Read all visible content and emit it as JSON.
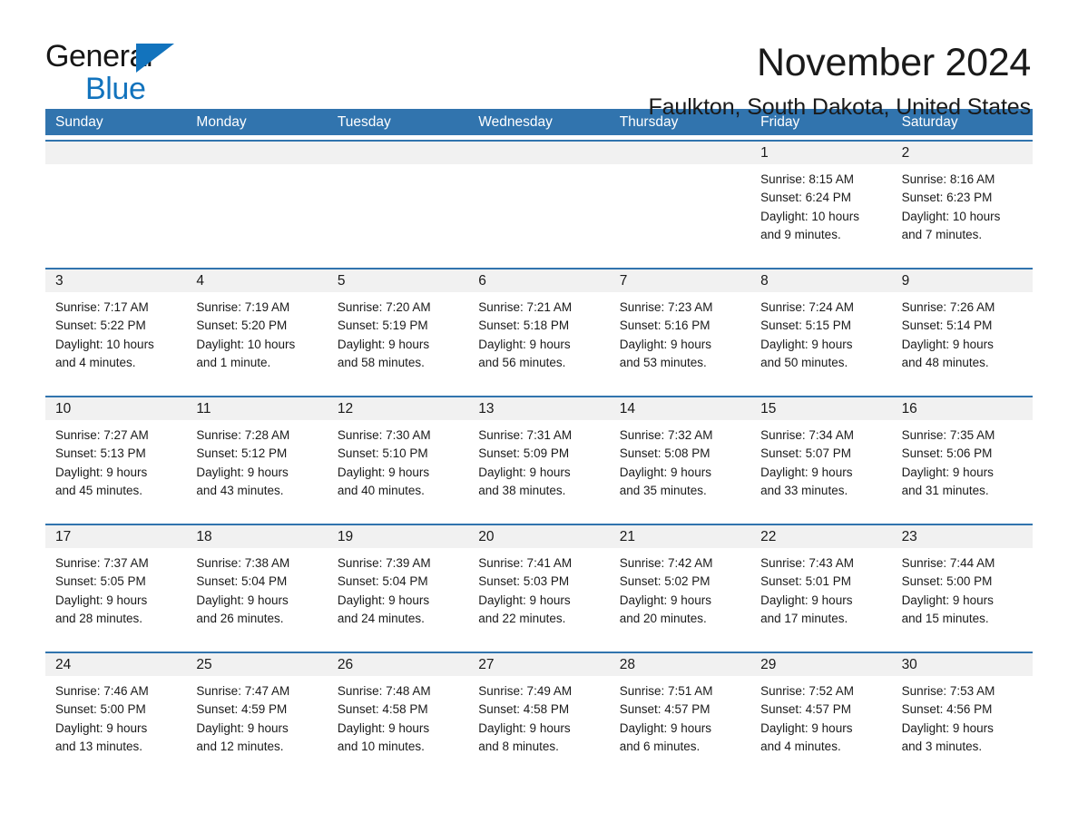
{
  "brand": {
    "name_part1": "General",
    "name_part2": "Blue",
    "logo_icon": "triangle-logo-icon",
    "accent_color": "#1273bd"
  },
  "header": {
    "month_title": "November 2024",
    "location": "Faulkton, South Dakota, United States"
  },
  "calendar": {
    "header_bg": "#3174ae",
    "daynum_band_bg": "#f1f1f1",
    "day_names": [
      "Sunday",
      "Monday",
      "Tuesday",
      "Wednesday",
      "Thursday",
      "Friday",
      "Saturday"
    ],
    "weeks": [
      [
        {
          "day": "",
          "lines": []
        },
        {
          "day": "",
          "lines": []
        },
        {
          "day": "",
          "lines": []
        },
        {
          "day": "",
          "lines": []
        },
        {
          "day": "",
          "lines": []
        },
        {
          "day": "1",
          "lines": [
            "Sunrise: 8:15 AM",
            "Sunset: 6:24 PM",
            "Daylight: 10 hours",
            "and 9 minutes."
          ]
        },
        {
          "day": "2",
          "lines": [
            "Sunrise: 8:16 AM",
            "Sunset: 6:23 PM",
            "Daylight: 10 hours",
            "and 7 minutes."
          ]
        }
      ],
      [
        {
          "day": "3",
          "lines": [
            "Sunrise: 7:17 AM",
            "Sunset: 5:22 PM",
            "Daylight: 10 hours",
            "and 4 minutes."
          ]
        },
        {
          "day": "4",
          "lines": [
            "Sunrise: 7:19 AM",
            "Sunset: 5:20 PM",
            "Daylight: 10 hours",
            "and 1 minute."
          ]
        },
        {
          "day": "5",
          "lines": [
            "Sunrise: 7:20 AM",
            "Sunset: 5:19 PM",
            "Daylight: 9 hours",
            "and 58 minutes."
          ]
        },
        {
          "day": "6",
          "lines": [
            "Sunrise: 7:21 AM",
            "Sunset: 5:18 PM",
            "Daylight: 9 hours",
            "and 56 minutes."
          ]
        },
        {
          "day": "7",
          "lines": [
            "Sunrise: 7:23 AM",
            "Sunset: 5:16 PM",
            "Daylight: 9 hours",
            "and 53 minutes."
          ]
        },
        {
          "day": "8",
          "lines": [
            "Sunrise: 7:24 AM",
            "Sunset: 5:15 PM",
            "Daylight: 9 hours",
            "and 50 minutes."
          ]
        },
        {
          "day": "9",
          "lines": [
            "Sunrise: 7:26 AM",
            "Sunset: 5:14 PM",
            "Daylight: 9 hours",
            "and 48 minutes."
          ]
        }
      ],
      [
        {
          "day": "10",
          "lines": [
            "Sunrise: 7:27 AM",
            "Sunset: 5:13 PM",
            "Daylight: 9 hours",
            "and 45 minutes."
          ]
        },
        {
          "day": "11",
          "lines": [
            "Sunrise: 7:28 AM",
            "Sunset: 5:12 PM",
            "Daylight: 9 hours",
            "and 43 minutes."
          ]
        },
        {
          "day": "12",
          "lines": [
            "Sunrise: 7:30 AM",
            "Sunset: 5:10 PM",
            "Daylight: 9 hours",
            "and 40 minutes."
          ]
        },
        {
          "day": "13",
          "lines": [
            "Sunrise: 7:31 AM",
            "Sunset: 5:09 PM",
            "Daylight: 9 hours",
            "and 38 minutes."
          ]
        },
        {
          "day": "14",
          "lines": [
            "Sunrise: 7:32 AM",
            "Sunset: 5:08 PM",
            "Daylight: 9 hours",
            "and 35 minutes."
          ]
        },
        {
          "day": "15",
          "lines": [
            "Sunrise: 7:34 AM",
            "Sunset: 5:07 PM",
            "Daylight: 9 hours",
            "and 33 minutes."
          ]
        },
        {
          "day": "16",
          "lines": [
            "Sunrise: 7:35 AM",
            "Sunset: 5:06 PM",
            "Daylight: 9 hours",
            "and 31 minutes."
          ]
        }
      ],
      [
        {
          "day": "17",
          "lines": [
            "Sunrise: 7:37 AM",
            "Sunset: 5:05 PM",
            "Daylight: 9 hours",
            "and 28 minutes."
          ]
        },
        {
          "day": "18",
          "lines": [
            "Sunrise: 7:38 AM",
            "Sunset: 5:04 PM",
            "Daylight: 9 hours",
            "and 26 minutes."
          ]
        },
        {
          "day": "19",
          "lines": [
            "Sunrise: 7:39 AM",
            "Sunset: 5:04 PM",
            "Daylight: 9 hours",
            "and 24 minutes."
          ]
        },
        {
          "day": "20",
          "lines": [
            "Sunrise: 7:41 AM",
            "Sunset: 5:03 PM",
            "Daylight: 9 hours",
            "and 22 minutes."
          ]
        },
        {
          "day": "21",
          "lines": [
            "Sunrise: 7:42 AM",
            "Sunset: 5:02 PM",
            "Daylight: 9 hours",
            "and 20 minutes."
          ]
        },
        {
          "day": "22",
          "lines": [
            "Sunrise: 7:43 AM",
            "Sunset: 5:01 PM",
            "Daylight: 9 hours",
            "and 17 minutes."
          ]
        },
        {
          "day": "23",
          "lines": [
            "Sunrise: 7:44 AM",
            "Sunset: 5:00 PM",
            "Daylight: 9 hours",
            "and 15 minutes."
          ]
        }
      ],
      [
        {
          "day": "24",
          "lines": [
            "Sunrise: 7:46 AM",
            "Sunset: 5:00 PM",
            "Daylight: 9 hours",
            "and 13 minutes."
          ]
        },
        {
          "day": "25",
          "lines": [
            "Sunrise: 7:47 AM",
            "Sunset: 4:59 PM",
            "Daylight: 9 hours",
            "and 12 minutes."
          ]
        },
        {
          "day": "26",
          "lines": [
            "Sunrise: 7:48 AM",
            "Sunset: 4:58 PM",
            "Daylight: 9 hours",
            "and 10 minutes."
          ]
        },
        {
          "day": "27",
          "lines": [
            "Sunrise: 7:49 AM",
            "Sunset: 4:58 PM",
            "Daylight: 9 hours",
            "and 8 minutes."
          ]
        },
        {
          "day": "28",
          "lines": [
            "Sunrise: 7:51 AM",
            "Sunset: 4:57 PM",
            "Daylight: 9 hours",
            "and 6 minutes."
          ]
        },
        {
          "day": "29",
          "lines": [
            "Sunrise: 7:52 AM",
            "Sunset: 4:57 PM",
            "Daylight: 9 hours",
            "and 4 minutes."
          ]
        },
        {
          "day": "30",
          "lines": [
            "Sunrise: 7:53 AM",
            "Sunset: 4:56 PM",
            "Daylight: 9 hours",
            "and 3 minutes."
          ]
        }
      ]
    ]
  }
}
